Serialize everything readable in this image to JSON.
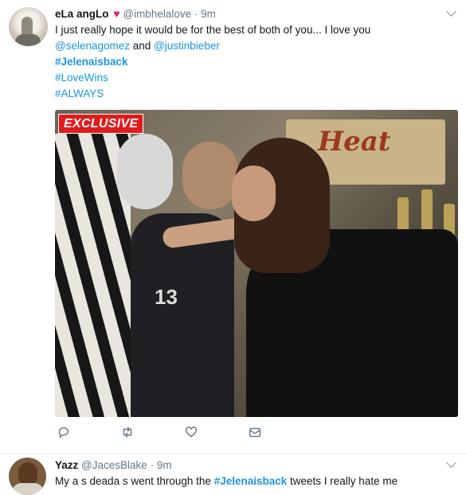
{
  "tweet1": {
    "name": "eLa angLo",
    "heart": "♥",
    "handle": "@imbhelalove",
    "dot": "·",
    "time": "9m",
    "line1": "I just really hope it would be for the best of both of you... I love you",
    "mention1": "@selenagomez",
    "and": "and",
    "mention2": "@justinbieber",
    "hashtags": [
      "#Jelenaisback",
      "#LoveWins",
      "#ALWAYS"
    ],
    "media_badge": "EXCLUSIVE",
    "media_sign": "Heat",
    "jersey_number": "13"
  },
  "actions": [
    "reply-icon",
    "retweet-icon",
    "like-icon",
    "message-icon"
  ],
  "tweet2": {
    "name": "Yazz",
    "handle": "@JacesBlake",
    "dot": "·",
    "time": "9m",
    "text_before": "My a",
    "gap1": "s deada",
    "gap2": "s went through the",
    "hashtag": "#Jelenaisback",
    "text_after": "tweets I really hate me"
  },
  "colors": {
    "link": "#1b95e0",
    "heart": "#e0245e",
    "meta": "#657786",
    "badge": "#e01b1b"
  }
}
